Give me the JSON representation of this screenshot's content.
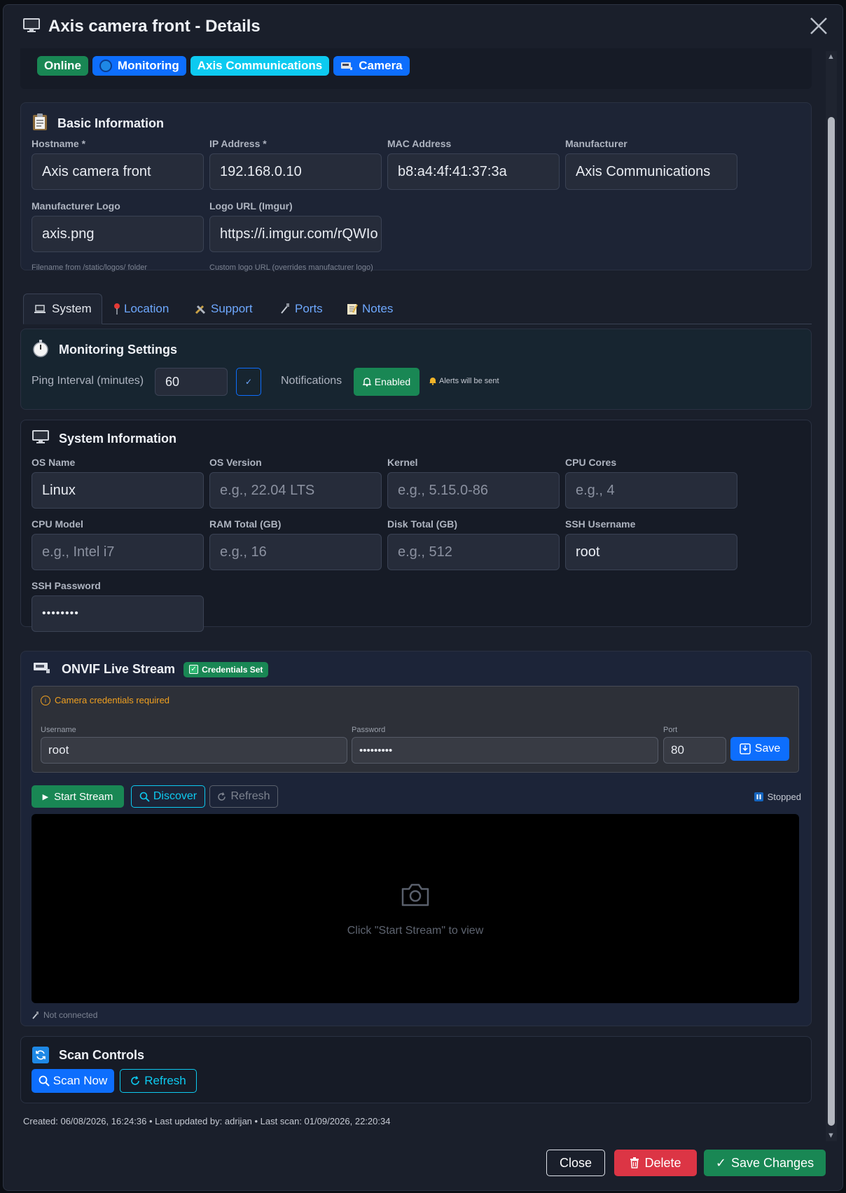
{
  "modal": {
    "title": "Axis camera front - Details"
  },
  "badges": {
    "online": "Online",
    "monitoring": "Monitoring",
    "manufacturer": "Axis Communications",
    "type": "Camera"
  },
  "basic": {
    "title": "Basic Information",
    "hostname_label": "Hostname *",
    "hostname": "Axis camera front",
    "ip_label": "IP Address *",
    "ip": "192.168.0.10",
    "mac_label": "MAC Address",
    "mac": "b8:a4:4f:41:37:3a",
    "manufacturer_label": "Manufacturer",
    "manufacturer": "Axis Communications",
    "logo_label": "Manufacturer Logo",
    "logo": "axis.png",
    "logo_hint": "Filename from /static/logos/ folder",
    "logo_url_label": "Logo URL (Imgur)",
    "logo_url": "https://i.imgur.com/rQWIo",
    "logo_url_hint": "Custom logo URL (overrides manufacturer logo)"
  },
  "tabs": {
    "system": "System",
    "location": "Location",
    "support": "Support",
    "ports": "Ports",
    "notes": "Notes"
  },
  "monitoring": {
    "title": "Monitoring Settings",
    "ping_label": "Ping Interval (minutes)",
    "ping_value": "60",
    "notifications_label": "Notifications",
    "notifications_btn": "Enabled",
    "alerts_text": "Alerts will be sent"
  },
  "system": {
    "title": "System Information",
    "os_name_label": "OS Name",
    "os_name": "Linux",
    "os_version_label": "OS Version",
    "os_version_ph": "e.g., 22.04 LTS",
    "kernel_label": "Kernel",
    "kernel_ph": "e.g., 5.15.0-86",
    "cpu_cores_label": "CPU Cores",
    "cpu_cores_ph": "e.g., 4",
    "cpu_model_label": "CPU Model",
    "cpu_model_ph": "e.g., Intel i7",
    "ram_label": "RAM Total (GB)",
    "ram_ph": "e.g., 16",
    "disk_label": "Disk Total (GB)",
    "disk_ph": "e.g., 512",
    "ssh_user_label": "SSH Username",
    "ssh_user": "root",
    "ssh_pass_label": "SSH Password",
    "ssh_pass": "••••••••"
  },
  "onvif": {
    "title": "ONVIF Live Stream",
    "cred_badge": "Credentials Set",
    "warning": "Camera credentials required",
    "username_label": "Username",
    "username": "root",
    "password_label": "Password",
    "password": "•••••••••",
    "port_label": "Port",
    "port": "80",
    "save_btn": "Save",
    "start_btn": "Start Stream",
    "discover_btn": "Discover",
    "refresh_btn": "Refresh",
    "status": "Stopped",
    "viewer_text": "Click \"Start Stream\" to view",
    "connection": "Not connected"
  },
  "scan": {
    "title": "Scan Controls",
    "scan_btn": "Scan Now",
    "refresh_btn": "Refresh"
  },
  "footer": {
    "meta": "Created: 06/08/2026, 16:24:36 • Last updated by: adrijan • Last scan: 01/09/2026, 22:20:34",
    "close": "Close",
    "delete": "Delete",
    "save": "Save Changes"
  }
}
